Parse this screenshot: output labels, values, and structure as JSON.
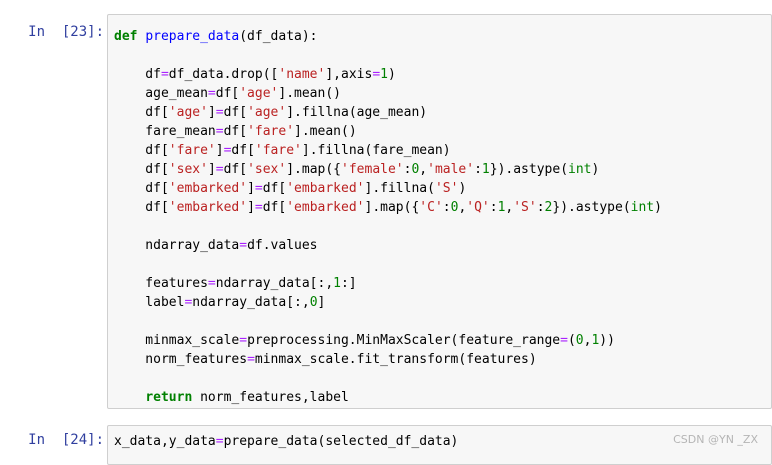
{
  "cells": [
    {
      "prompt": "In  [23]:",
      "code": [
        [
          {
            "t": "def",
            "c": "kw"
          },
          {
            "t": " "
          },
          {
            "t": "prepare_data",
            "c": "fn"
          },
          {
            "t": "(df_data):"
          }
        ],
        [],
        [
          {
            "t": "    df"
          },
          {
            "t": "=",
            "c": "op"
          },
          {
            "t": "df_data.drop(["
          },
          {
            "t": "'name'",
            "c": "st"
          },
          {
            "t": "],axis"
          },
          {
            "t": "=",
            "c": "op"
          },
          {
            "t": "1",
            "c": "nu"
          },
          {
            "t": ")"
          }
        ],
        [
          {
            "t": "    age_mean"
          },
          {
            "t": "=",
            "c": "op"
          },
          {
            "t": "df["
          },
          {
            "t": "'age'",
            "c": "st"
          },
          {
            "t": "].mean()"
          }
        ],
        [
          {
            "t": "    df["
          },
          {
            "t": "'age'",
            "c": "st"
          },
          {
            "t": "]"
          },
          {
            "t": "=",
            "c": "op"
          },
          {
            "t": "df["
          },
          {
            "t": "'age'",
            "c": "st"
          },
          {
            "t": "].fillna(age_mean)"
          }
        ],
        [
          {
            "t": "    fare_mean"
          },
          {
            "t": "=",
            "c": "op"
          },
          {
            "t": "df["
          },
          {
            "t": "'fare'",
            "c": "st"
          },
          {
            "t": "].mean()"
          }
        ],
        [
          {
            "t": "    df["
          },
          {
            "t": "'fare'",
            "c": "st"
          },
          {
            "t": "]"
          },
          {
            "t": "=",
            "c": "op"
          },
          {
            "t": "df["
          },
          {
            "t": "'fare'",
            "c": "st"
          },
          {
            "t": "].fillna(fare_mean)"
          }
        ],
        [
          {
            "t": "    df["
          },
          {
            "t": "'sex'",
            "c": "st"
          },
          {
            "t": "]"
          },
          {
            "t": "=",
            "c": "op"
          },
          {
            "t": "df["
          },
          {
            "t": "'sex'",
            "c": "st"
          },
          {
            "t": "].map({"
          },
          {
            "t": "'female'",
            "c": "st"
          },
          {
            "t": ":"
          },
          {
            "t": "0",
            "c": "nu"
          },
          {
            "t": ","
          },
          {
            "t": "'male'",
            "c": "st"
          },
          {
            "t": ":"
          },
          {
            "t": "1",
            "c": "nu"
          },
          {
            "t": "}).astype("
          },
          {
            "t": "int",
            "c": "bi"
          },
          {
            "t": ")"
          }
        ],
        [
          {
            "t": "    df["
          },
          {
            "t": "'embarked'",
            "c": "st"
          },
          {
            "t": "]"
          },
          {
            "t": "=",
            "c": "op"
          },
          {
            "t": "df["
          },
          {
            "t": "'embarked'",
            "c": "st"
          },
          {
            "t": "].fillna("
          },
          {
            "t": "'S'",
            "c": "st"
          },
          {
            "t": ")"
          }
        ],
        [
          {
            "t": "    df["
          },
          {
            "t": "'embarked'",
            "c": "st"
          },
          {
            "t": "]"
          },
          {
            "t": "=",
            "c": "op"
          },
          {
            "t": "df["
          },
          {
            "t": "'embarked'",
            "c": "st"
          },
          {
            "t": "].map({"
          },
          {
            "t": "'C'",
            "c": "st"
          },
          {
            "t": ":"
          },
          {
            "t": "0",
            "c": "nu"
          },
          {
            "t": ","
          },
          {
            "t": "'Q'",
            "c": "st"
          },
          {
            "t": ":"
          },
          {
            "t": "1",
            "c": "nu"
          },
          {
            "t": ","
          },
          {
            "t": "'S'",
            "c": "st"
          },
          {
            "t": ":"
          },
          {
            "t": "2",
            "c": "nu"
          },
          {
            "t": "}).astype("
          },
          {
            "t": "int",
            "c": "bi"
          },
          {
            "t": ")"
          }
        ],
        [],
        [
          {
            "t": "    ndarray_data"
          },
          {
            "t": "=",
            "c": "op"
          },
          {
            "t": "df.values"
          }
        ],
        [],
        [
          {
            "t": "    features"
          },
          {
            "t": "=",
            "c": "op"
          },
          {
            "t": "ndarray_data[:,"
          },
          {
            "t": "1",
            "c": "nu"
          },
          {
            "t": ":]"
          }
        ],
        [
          {
            "t": "    label"
          },
          {
            "t": "=",
            "c": "op"
          },
          {
            "t": "ndarray_data[:,"
          },
          {
            "t": "0",
            "c": "nu"
          },
          {
            "t": "]"
          }
        ],
        [],
        [
          {
            "t": "    minmax_scale"
          },
          {
            "t": "=",
            "c": "op"
          },
          {
            "t": "preprocessing.MinMaxScaler(feature_range"
          },
          {
            "t": "=",
            "c": "op"
          },
          {
            "t": "("
          },
          {
            "t": "0",
            "c": "nu"
          },
          {
            "t": ","
          },
          {
            "t": "1",
            "c": "nu"
          },
          {
            "t": "))"
          }
        ],
        [
          {
            "t": "    norm_features"
          },
          {
            "t": "=",
            "c": "op"
          },
          {
            "t": "minmax_scale.fit_transform(features)"
          }
        ],
        [],
        [
          {
            "t": "    "
          },
          {
            "t": "return",
            "c": "kw"
          },
          {
            "t": " norm_features,label"
          }
        ]
      ]
    },
    {
      "prompt": "In  [24]:",
      "code": [
        [
          {
            "t": "x_data,y_data"
          },
          {
            "t": "=",
            "c": "op"
          },
          {
            "t": "prepare_data(selected_df_data)"
          }
        ]
      ]
    }
  ],
  "watermark": "CSDN @YN _ZX"
}
